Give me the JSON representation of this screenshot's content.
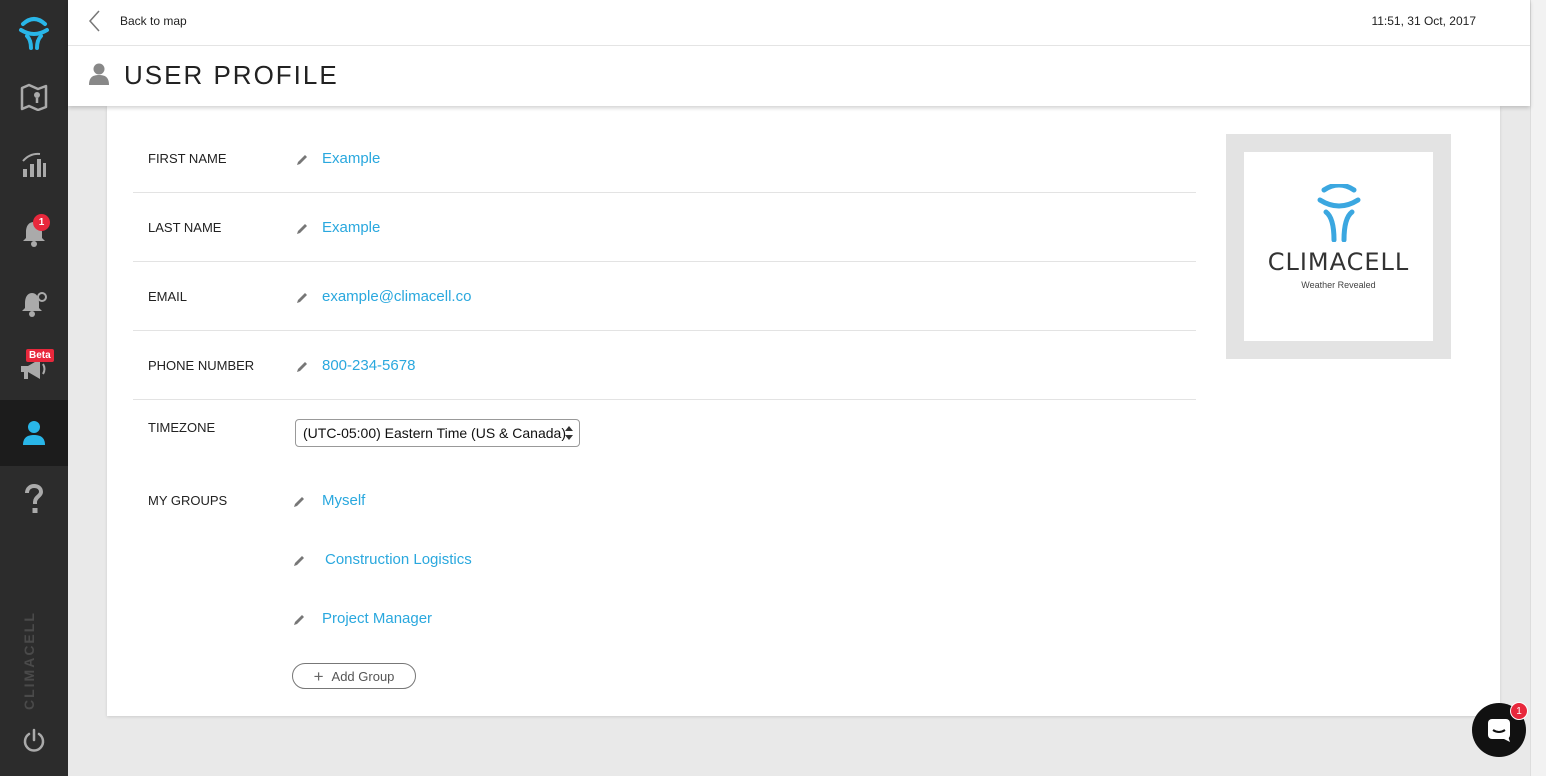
{
  "sidebar": {
    "notifications_badge": "1",
    "beta_badge": "Beta",
    "brand_vertical": "CLIMACELL",
    "items": [
      {
        "name": "logo-icon"
      },
      {
        "name": "map-icon"
      },
      {
        "name": "signal-chart-icon"
      },
      {
        "name": "notifications-icon"
      },
      {
        "name": "alert-settings-icon"
      },
      {
        "name": "broadcast-icon"
      },
      {
        "name": "user-profile-icon"
      },
      {
        "name": "help-icon"
      },
      {
        "name": "power-icon"
      }
    ],
    "accent": "#29b6e8"
  },
  "header": {
    "back_label": "Back to map",
    "timestamp": "11:51, 31 Oct, 2017",
    "title": "USER PROFILE"
  },
  "profile": {
    "fields": [
      {
        "label": "FIRST NAME",
        "value": "Example"
      },
      {
        "label": "LAST NAME",
        "value": "Example"
      },
      {
        "label": "EMAIL",
        "value": "example@climacell.co"
      },
      {
        "label": "PHONE NUMBER",
        "value": "800-234-5678"
      }
    ],
    "timezone": {
      "label": "TIMEZONE",
      "selected": "(UTC-05:00) Eastern Time (US & Canada)"
    },
    "groups": {
      "label": "MY GROUPS",
      "items": [
        "Myself",
        "Construction Logistics",
        "Project Manager"
      ],
      "add_label": "Add Group"
    }
  },
  "logo": {
    "wordmark": "CLIMACELL",
    "tagline": "Weather Revealed"
  },
  "chat": {
    "badge": "1"
  },
  "colors": {
    "link": "#2aa8de",
    "sidebar_bg": "#2c2c2c",
    "badge": "#e8283c"
  }
}
